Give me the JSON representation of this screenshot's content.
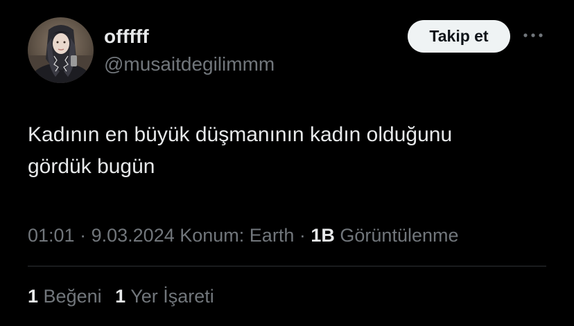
{
  "tweet": {
    "author": {
      "display_name": "offfff",
      "handle": "@musaitdegilimmm"
    },
    "follow_label": "Takip et",
    "more_icon": "more-horizontal-icon",
    "text_lines": [
      "Kadının en büyük düşmanının kadın olduğunu",
      "gördük bugün"
    ],
    "meta": {
      "time": "01:01",
      "separator": "·",
      "date": "9.03.2024",
      "location_label": "Konum: Earth",
      "views_count": "1B",
      "views_label": "Görüntülenme"
    },
    "stats": {
      "likes_count": "1",
      "likes_label": "Beğeni",
      "bookmarks_count": "1",
      "bookmarks_label": "Yer İşareti"
    }
  },
  "colors": {
    "background": "#000000",
    "primary_text": "#e7e9ea",
    "secondary_text": "#71767b",
    "divider": "#2f3336",
    "follow_button_bg": "#eff3f4",
    "follow_button_text": "#0f1419"
  }
}
